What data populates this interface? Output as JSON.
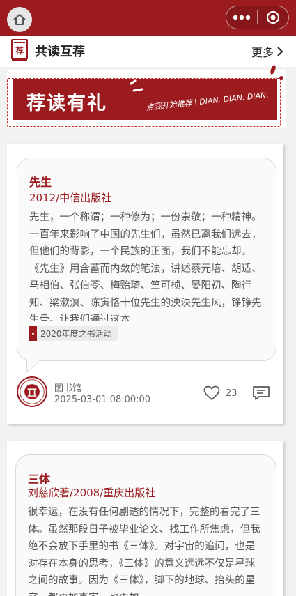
{
  "topbar": {
    "home_icon": "home-icon",
    "menu_icon": "more-dots-icon",
    "close_icon": "target-close-icon",
    "accent": "#9b1b1f"
  },
  "section": {
    "icon_char": "荐",
    "title": "共读互荐",
    "more_label": "更多"
  },
  "banner": {
    "title": "荐读有礼",
    "subtitle": "点我开始推荐 | DIAN. DIAN. DIAN."
  },
  "posts": [
    {
      "title": "先生",
      "meta": "2012/中信出版社",
      "description": "先生，一个称谓；一种修为；一份崇敬；一种精神。一百年来影响了中国的先生们，虽然已离我们远去，但他们的背影，一个民族的正面，我们不能忘却。《先生》用含蓄而内敛的笔法，讲述蔡元培、胡适、马相伯、张伯苓、梅贻琦、竺可桢、晏阳初、陶行知、梁漱溟、陈寅恪十位先生的泱泱先生风，铮铮先生骨。让我们通过这本…",
      "tag": "2020年度之书活动",
      "author": "图书馆",
      "time": "2025-03-01 08:00:00",
      "likes": "23"
    },
    {
      "title": "三体",
      "meta": "刘慈欣著/2008/重庆出版社",
      "description": "很幸运，在没有任何剧透的情况下，完整的看完了三体。虽然那段日子被毕业论文、找工作所焦虑，但我绝不会放下手里的书《三体》。对宇宙的追问，也是对存在本身的思考，《三体》的意义远远不仅是星球之间的故事。因为《三体》，脚下的地球、抬头的星空，都更加真实，也更加"
    }
  ]
}
